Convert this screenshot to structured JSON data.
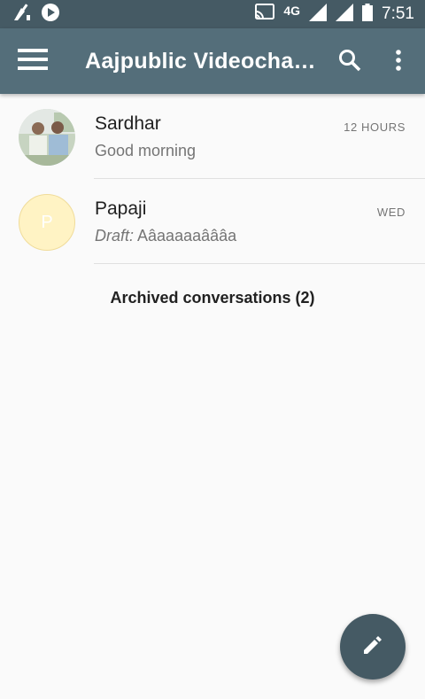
{
  "status_bar": {
    "network": "4G",
    "time": "7:51",
    "icons": [
      "broom-icon",
      "app-notification-icon",
      "cast-icon",
      "signal-icon",
      "signal-icon",
      "battery-icon"
    ]
  },
  "app_bar": {
    "title": "Aajpublic Videocha…",
    "icons": [
      "menu-icon",
      "search-icon",
      "more-vert-icon"
    ]
  },
  "conversations": [
    {
      "name": "Sardhar",
      "time": "12 HOURS",
      "snippet": "Good morning",
      "draft": false,
      "avatar": "photo"
    },
    {
      "name": "Papaji",
      "time": "WED",
      "draft_label": "Draft:",
      "snippet": "Aâaaaaaâââa",
      "draft": true,
      "avatar_letter": "P"
    }
  ],
  "archived_label": "Archived conversations (2)",
  "fab": {
    "icon": "edit-icon"
  },
  "colors": {
    "status_bar": "#455a64",
    "app_bar": "#546e7a",
    "fab": "#455a64",
    "avatar_placeholder": "#fff3c4"
  }
}
